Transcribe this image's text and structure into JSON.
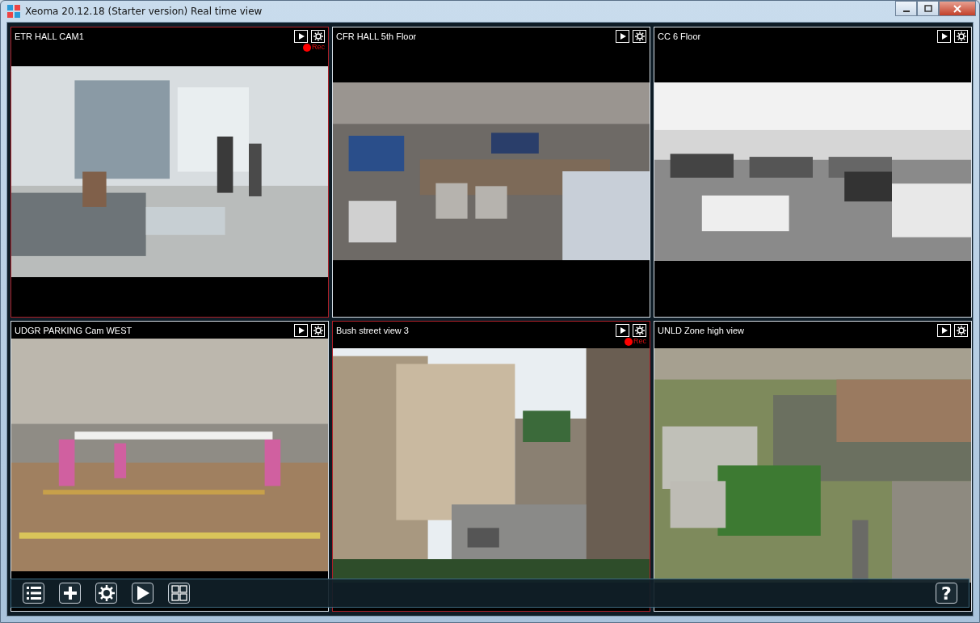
{
  "window": {
    "title": "Xeoma 20.12.18 (Starter version) Real time view"
  },
  "cameras": [
    {
      "name": "ETR HALL CAM1",
      "recording": true,
      "rec_label": "Rec"
    },
    {
      "name": "CFR HALL 5th Floor",
      "recording": false
    },
    {
      "name": "CC 6 Floor",
      "recording": false
    },
    {
      "name": "UDGR PARKING Cam WEST",
      "recording": false
    },
    {
      "name": "Bush street view 3",
      "recording": true,
      "rec_label": "Rec"
    },
    {
      "name": "UNLD Zone high view",
      "recording": false
    }
  ],
  "toolbar": {
    "help": "?"
  }
}
